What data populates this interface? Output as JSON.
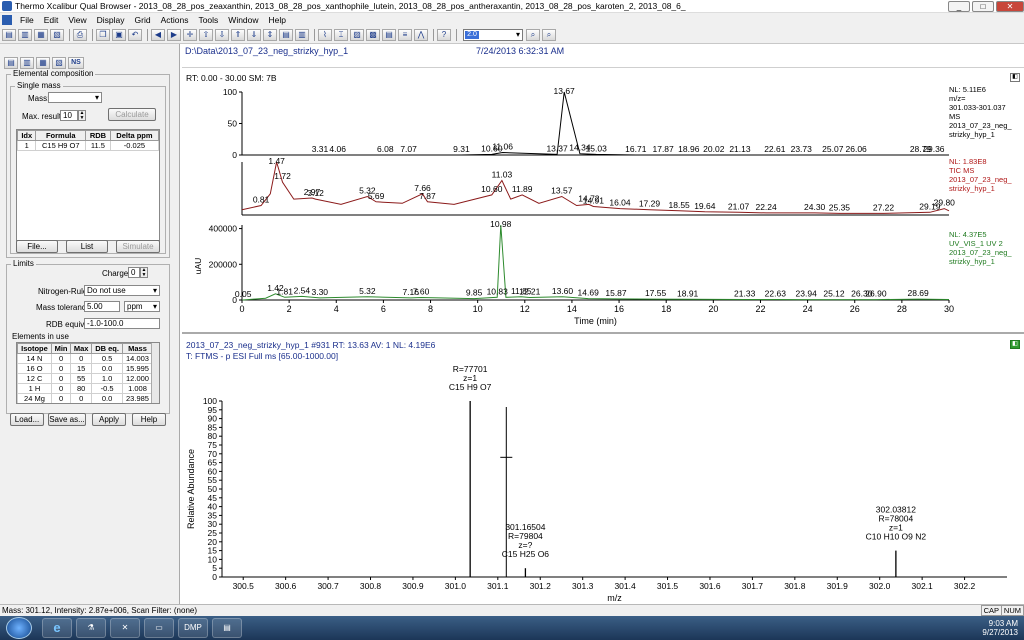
{
  "window": {
    "title": "Thermo Xcalibur Qual Browser - 2013_08_28_pos_zeaxanthin, 2013_08_28_pos_xanthophile_lutein, 2013_08_28_pos_antheraxantin, 2013_08_28_pos_karoten_2, 2013_08_6_"
  },
  "menu": [
    "File",
    "Edit",
    "View",
    "Display",
    "Grid",
    "Actions",
    "Tools",
    "Window",
    "Help"
  ],
  "toolbar": {
    "zoom_value": "2.0"
  },
  "left": {
    "tabs_label": "NS",
    "elemental_composition": "Elemental composition",
    "single_mass": "Single mass",
    "mass_label": "Mass:",
    "max_results_label": "Max. results",
    "max_results_value": "10",
    "calculate": "Calculate",
    "results_headers": [
      "Idx",
      "Formula",
      "RDB",
      "Delta ppm"
    ],
    "results_rows": [
      [
        "1",
        "C15 H9 O7",
        "11.5",
        "-0.025"
      ]
    ],
    "file_btn": "File...",
    "list_btn": "List",
    "simulate_btn": "Simulate",
    "limits": "Limits",
    "charge_label": "Charge:",
    "charge_value": "0",
    "nitrogen_rule_label": "Nitrogen-Rule:",
    "nitrogen_rule_value": "Do not use",
    "mass_tolerance_label": "Mass tolerance",
    "mass_tolerance_value": "5.00",
    "mass_tolerance_unit": "ppm",
    "rdb_label": "RDB equiv:",
    "rdb_value": "-1.0-100.0",
    "elements_in_use": "Elements in use",
    "elements_headers": [
      "Isotope",
      "Min",
      "Max",
      "DB eq.",
      "Mass"
    ],
    "elements_rows": [
      [
        "14 N",
        "0",
        "0",
        "0.5",
        "14.003"
      ],
      [
        "16 O",
        "0",
        "15",
        "0.0",
        "15.995"
      ],
      [
        "12 C",
        "0",
        "55",
        "1.0",
        "12.000"
      ],
      [
        "1 H",
        "0",
        "80",
        "-0.5",
        "1.008"
      ],
      [
        "24 Mg",
        "0",
        "0",
        "0.0",
        "23.985"
      ]
    ],
    "load_btn": "Load...",
    "save_btn": "Save as...",
    "apply_btn": "Apply",
    "help_btn": "Help"
  },
  "chrom": {
    "path": "D:\\Data\\2013_07_23_neg_strizky_hyp_1",
    "datetime": "7/24/2013 6:32:31 AM",
    "rt_line": "RT: 0.00 - 30.00   SM: 7B",
    "xlabel": "Time (min)",
    "uv_ylabel": "uAU",
    "trace1_info": [
      "NL: 5.11E6",
      "m/z=",
      "301.033-301.037",
      "MS",
      "2013_07_23_neg_",
      "strizky_hyp_1"
    ],
    "trace2_info": [
      "NL: 1.83E8",
      "TIC  MS",
      "2013_07_23_neg_",
      "strizky_hyp_1"
    ],
    "trace3_info": [
      "NL: 4.37E5",
      "UV_VIS_1  UV 2",
      "2013_07_23_neg_",
      "strizky_hyp_1"
    ]
  },
  "spectrum": {
    "header": "2013_07_23_neg_strizky_hyp_1 #931   RT: 13.63   AV: 1   NL: 4.19E6",
    "filter": "T: FTMS - p ESI Full ms [65.00-1000.00]",
    "xlabel": "m/z",
    "ylabel": "Relative Abundance"
  },
  "status": {
    "text": "Mass: 301.12, Intensity: 2.87e+006, Scan Filter: (none)",
    "cap": "CAP",
    "num": "NUM"
  },
  "taskbar": {
    "dmp": "DMP",
    "time": "9:03 AM",
    "date": "9/27/2013"
  },
  "chart_data": [
    {
      "type": "line",
      "title": "m/z=301.033-301.037 MS",
      "x": [
        0,
        3.31,
        4.06,
        6.08,
        7.07,
        9.31,
        10.6,
        11.06,
        13.37,
        13.67,
        14.34,
        15.03,
        16.71,
        17.87,
        18.96,
        20.02,
        21.13,
        22.61,
        23.73,
        25.07,
        26.06,
        28.79,
        29.36,
        30
      ],
      "y": [
        0,
        0,
        0,
        0,
        0,
        0,
        1,
        4,
        1,
        100,
        2,
        1,
        0,
        0,
        0,
        0,
        0,
        0,
        0,
        0,
        0,
        0,
        0,
        0
      ],
      "peak_labels": [
        "3.31",
        "4.06",
        "6.08",
        "7.07",
        "9.31",
        "10.60",
        "11.06",
        "13.37",
        "13.67",
        "14.34",
        "15.03",
        "16.71",
        "17.87",
        "18.96",
        "20.02",
        "21.13",
        "22.61",
        "23.73",
        "25.07",
        "26.06",
        "28.79",
        "29.36"
      ],
      "peak_x": [
        3.31,
        4.06,
        6.08,
        7.07,
        9.31,
        10.6,
        11.06,
        13.37,
        13.67,
        14.34,
        15.03,
        16.71,
        17.87,
        18.96,
        20.02,
        21.13,
        22.61,
        23.73,
        25.07,
        26.06,
        28.79,
        29.36
      ],
      "ylim": [
        0,
        100
      ],
      "yticks": [
        0,
        50,
        100
      ],
      "color": "#000000"
    },
    {
      "type": "line",
      "title": "TIC MS",
      "x": [
        0,
        0.81,
        1.2,
        1.47,
        1.72,
        2.2,
        2.97,
        3.12,
        4.2,
        5.32,
        5.69,
        6.8,
        7.66,
        7.87,
        9.0,
        10.6,
        11.03,
        11.4,
        11.89,
        12.6,
        13.57,
        14.2,
        14.72,
        14.91,
        16.04,
        17.29,
        18.55,
        19.64,
        21.07,
        22.24,
        24.3,
        25.35,
        27.22,
        29.19,
        29.8,
        30
      ],
      "y": [
        10,
        18,
        40,
        100,
        62,
        30,
        32,
        30,
        20,
        35,
        25,
        22,
        40,
        25,
        20,
        38,
        65,
        30,
        38,
        22,
        35,
        18,
        20,
        16,
        12,
        10,
        8,
        6,
        5,
        4,
        4,
        3,
        3,
        5,
        12,
        8
      ],
      "peak_labels": [
        "0.81",
        "1.47",
        "1.72",
        "2.97",
        "3.12",
        "5.32",
        "5.69",
        "7.66",
        "7.87",
        "10.60",
        "11.03",
        "11.89",
        "13.57",
        "14.72",
        "14.91",
        "16.04",
        "17.29",
        "18.55",
        "19.64",
        "21.07",
        "22.24",
        "24.30",
        "25.35",
        "27.22",
        "29.19",
        "29.80"
      ],
      "peak_x": [
        0.81,
        1.47,
        1.72,
        2.97,
        3.12,
        5.32,
        5.69,
        7.66,
        7.87,
        10.6,
        11.03,
        11.89,
        13.57,
        14.72,
        14.91,
        16.04,
        17.29,
        18.55,
        19.64,
        21.07,
        22.24,
        24.3,
        25.35,
        27.22,
        29.19,
        29.8
      ],
      "ylim": [
        0,
        100
      ],
      "color": "#8b1a1a"
    },
    {
      "type": "line",
      "title": "UV_VIS_1 UV 2",
      "x": [
        0,
        0.05,
        1.0,
        1.42,
        1.81,
        2.54,
        3.3,
        5.32,
        7.16,
        7.6,
        9.85,
        10.83,
        10.98,
        11.2,
        11.85,
        12.21,
        13.6,
        14.69,
        15.87,
        17.55,
        18.91,
        21.33,
        22.63,
        23.94,
        25.12,
        26.3,
        26.9,
        28.69,
        30
      ],
      "y": [
        0,
        0,
        10000,
        35000,
        15000,
        20000,
        12000,
        18000,
        12000,
        14000,
        8000,
        15000,
        420000,
        15000,
        18000,
        14000,
        18000,
        8000,
        6000,
        5000,
        4000,
        3000,
        3000,
        2000,
        2000,
        2000,
        2000,
        5000,
        3000
      ],
      "peak_labels": [
        "0.05",
        "1.42",
        "1.81",
        "2.54",
        "3.30",
        "5.32",
        "7.16",
        "7.60",
        "9.85",
        "10.83",
        "10.98",
        "11.85",
        "12.21",
        "13.60",
        "14.69",
        "15.87",
        "17.55",
        "18.91",
        "21.33",
        "22.63",
        "23.94",
        "25.12",
        "26.30",
        "26.90",
        "28.69"
      ],
      "peak_x": [
        0.05,
        1.42,
        1.81,
        2.54,
        3.3,
        5.32,
        7.16,
        7.6,
        9.85,
        10.83,
        10.98,
        11.85,
        12.21,
        13.6,
        14.69,
        15.87,
        17.55,
        18.91,
        21.33,
        22.63,
        23.94,
        25.12,
        26.3,
        26.9,
        28.69
      ],
      "ylim": [
        0,
        420000
      ],
      "yticks": [
        0,
        200000,
        400000
      ],
      "xlim": [
        0,
        30
      ],
      "xticks": [
        0,
        2,
        4,
        6,
        8,
        10,
        12,
        14,
        16,
        18,
        20,
        22,
        24,
        26,
        28,
        30
      ],
      "xlabel": "Time (min)",
      "color": "#2e8b2e"
    },
    {
      "type": "bar",
      "title": "FTMS - p ESI Full ms",
      "x": [
        301.03482,
        301.16504,
        302.03812
      ],
      "y": [
        100,
        5,
        15
      ],
      "annotations": [
        [
          "301.03482",
          "R=77701",
          "z=1",
          "C15 H9 O7"
        ],
        [
          "301.16504",
          "R=79804",
          "z=?",
          "C15 H25 O6"
        ],
        [
          "302.03812",
          "R=78004",
          "z=1",
          "C10 H10 O9 N2"
        ]
      ],
      "xlim": [
        300.45,
        302.3
      ],
      "xticks": [
        300.5,
        300.6,
        300.7,
        300.8,
        300.9,
        301.0,
        301.1,
        301.2,
        301.3,
        301.4,
        301.5,
        301.6,
        301.7,
        301.8,
        301.9,
        302.0,
        302.1,
        302.2
      ],
      "ylim": [
        0,
        100
      ],
      "yticks": [
        0,
        5,
        10,
        15,
        20,
        25,
        30,
        35,
        40,
        45,
        50,
        55,
        60,
        65,
        70,
        75,
        80,
        85,
        90,
        95,
        100
      ],
      "xlabel": "m/z",
      "ylabel": "Relative Abundance"
    }
  ]
}
